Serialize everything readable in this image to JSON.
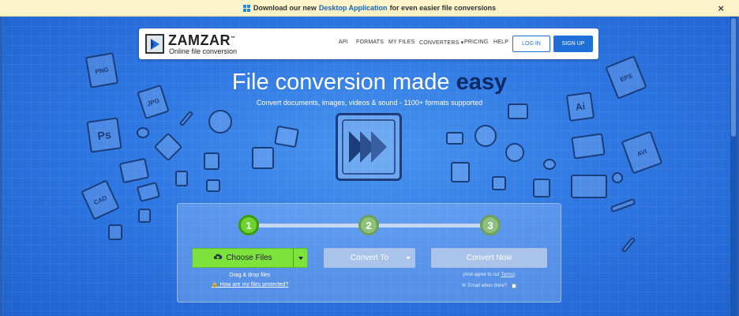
{
  "banner": {
    "text_before": "Download our new",
    "link": "Desktop Application",
    "text_after": "for even easier file conversions",
    "close": "×"
  },
  "navbar": {
    "logo_name": "ZAMZAR",
    "logo_tm": "™",
    "logo_tagline": "Online file conversion",
    "links": [
      "API",
      "FORMATS",
      "MY FILES",
      "CONVERTERS",
      "PRICING",
      "HELP"
    ],
    "login": "LOG IN",
    "signup": "SIGN UP"
  },
  "hero": {
    "headline_plain": "File conversion made",
    "headline_emphasis": "easy",
    "subheadline": "Convert documents, images, videos & sound - 1100+ formats supported"
  },
  "decor_labels": [
    "PNG",
    "JPG",
    "Ps",
    "CAD",
    "EPS",
    "Ai",
    "AVI"
  ],
  "converter": {
    "steps": [
      "1",
      "2",
      "3"
    ],
    "active_step": 1,
    "choose_files": "Choose Files",
    "convert_to": "Convert To",
    "convert_now": "Convert Now",
    "drag_drop": "Drag & drop files",
    "protected_link": "How are my files protected?",
    "agree_prefix": "(And agree to our",
    "agree_link": "Terms",
    "agree_suffix": ")",
    "email_label": "Email when done?"
  },
  "colors": {
    "brand_blue": "#1e6fd9",
    "hero_blue": "#2f78e2",
    "accent_green": "#7de23b",
    "emphasis_navy": "#0c2a66",
    "banner_yellow": "#fdf3c9"
  }
}
